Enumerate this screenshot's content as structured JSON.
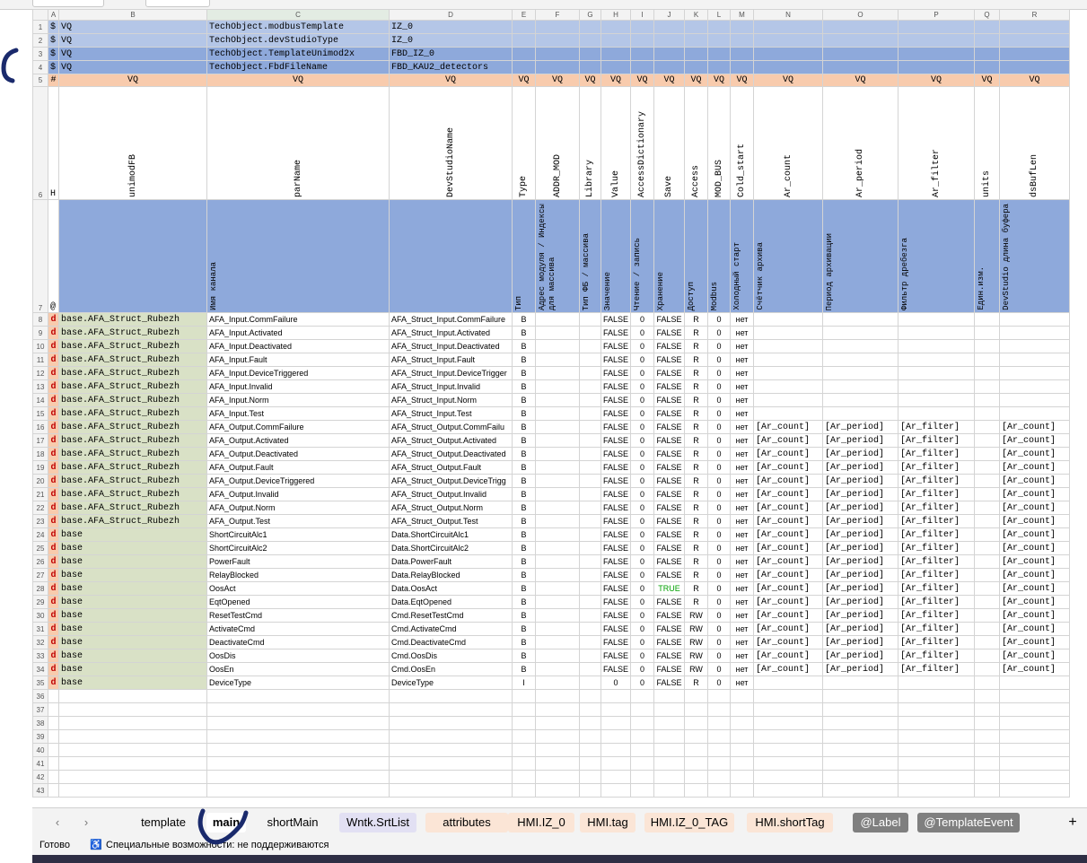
{
  "columns": [
    "A",
    "B",
    "C",
    "D",
    "E",
    "F",
    "G",
    "H",
    "I",
    "J",
    "K",
    "L",
    "M",
    "N",
    "O",
    "P",
    "Q",
    "R"
  ],
  "template_rows": [
    {
      "num": "1",
      "a": "$",
      "b": "VQ",
      "c": "TechObject.modbusTemplate",
      "d": "IZ_0"
    },
    {
      "num": "2",
      "a": "$",
      "b": "VQ",
      "c": "TechObject.devStudioType",
      "d": "IZ_0"
    },
    {
      "num": "3",
      "a": "$",
      "b": "VQ",
      "c": "TechObject.TemplateUnimod2x",
      "d": "FBD_IZ_0"
    },
    {
      "num": "4",
      "a": "$",
      "b": "VQ",
      "c": "TechObject.FbdFileName",
      "d": "FBD_KAU2_detectors"
    }
  ],
  "row5": {
    "num": "5",
    "a": "#",
    "cells": [
      "VQ",
      "VQ",
      "VQ",
      "VQ",
      "VQ",
      "VQ",
      "VQ",
      "VQ",
      "VQ",
      "VQ",
      "VQ",
      "VQ",
      "VQ",
      "VQ",
      "VQ",
      "VQ",
      "VQ"
    ]
  },
  "row6": {
    "num": "6",
    "a": "H",
    "cells": [
      "unimodFB",
      "parName",
      "DevStudioName",
      "Type",
      "ADDR_MOD",
      "Library",
      "Value",
      "AccessDictionary",
      "Save",
      "Access",
      "MOD_BUS",
      "Cold_start",
      "Ar_count",
      "Ar_period",
      "Ar_filter",
      "units",
      "dsBufLen"
    ]
  },
  "row7": {
    "num": "7",
    "a": "@",
    "cells": [
      "",
      "Имя канала",
      "",
      "Тип",
      "Адрес модуля / Индексы для массива",
      "Тип ФБ / массива",
      "Значение",
      "Чтение / запись",
      "Хранение",
      "Доступ",
      "Modbus",
      "Холодный старт",
      "Счётчик архива",
      "Период архивации",
      "Фильтр дребезга",
      "Един.изм.",
      "DevStudio длина буфера"
    ]
  },
  "data_rows": [
    {
      "num": "8",
      "a": "d",
      "b": "base.AFA_Struct_Rubezh",
      "c": "AFA_Input.CommFailure",
      "d": "AFA_Struct_Input.CommFailure",
      "e": "B",
      "h": "FALSE",
      "i": "0",
      "j": "FALSE",
      "k": "R",
      "l": "0",
      "m": "нет",
      "n": "",
      "o": "",
      "p": "",
      "r": ""
    },
    {
      "num": "9",
      "a": "d",
      "b": "base.AFA_Struct_Rubezh",
      "c": "AFA_Input.Activated",
      "d": "AFA_Struct_Input.Activated",
      "e": "B",
      "h": "FALSE",
      "i": "0",
      "j": "FALSE",
      "k": "R",
      "l": "0",
      "m": "нет",
      "n": "",
      "o": "",
      "p": "",
      "r": ""
    },
    {
      "num": "10",
      "a": "d",
      "b": "base.AFA_Struct_Rubezh",
      "c": "AFA_Input.Deactivated",
      "d": "AFA_Struct_Input.Deactivated",
      "e": "B",
      "h": "FALSE",
      "i": "0",
      "j": "FALSE",
      "k": "R",
      "l": "0",
      "m": "нет",
      "n": "",
      "o": "",
      "p": "",
      "r": ""
    },
    {
      "num": "11",
      "a": "d",
      "b": "base.AFA_Struct_Rubezh",
      "c": "AFA_Input.Fault",
      "d": "AFA_Struct_Input.Fault",
      "e": "B",
      "h": "FALSE",
      "i": "0",
      "j": "FALSE",
      "k": "R",
      "l": "0",
      "m": "нет",
      "n": "",
      "o": "",
      "p": "",
      "r": ""
    },
    {
      "num": "12",
      "a": "d",
      "b": "base.AFA_Struct_Rubezh",
      "c": "AFA_Input.DeviceTriggered",
      "d": "AFA_Struct_Input.DeviceTrigger",
      "e": "B",
      "h": "FALSE",
      "i": "0",
      "j": "FALSE",
      "k": "R",
      "l": "0",
      "m": "нет",
      "n": "",
      "o": "",
      "p": "",
      "r": ""
    },
    {
      "num": "13",
      "a": "d",
      "b": "base.AFA_Struct_Rubezh",
      "c": "AFA_Input.Invalid",
      "d": "AFA_Struct_Input.Invalid",
      "e": "B",
      "h": "FALSE",
      "i": "0",
      "j": "FALSE",
      "k": "R",
      "l": "0",
      "m": "нет",
      "n": "",
      "o": "",
      "p": "",
      "r": ""
    },
    {
      "num": "14",
      "a": "d",
      "b": "base.AFA_Struct_Rubezh",
      "c": "AFA_Input.Norm",
      "d": "AFA_Struct_Input.Norm",
      "e": "B",
      "h": "FALSE",
      "i": "0",
      "j": "FALSE",
      "k": "R",
      "l": "0",
      "m": "нет",
      "n": "",
      "o": "",
      "p": "",
      "r": ""
    },
    {
      "num": "15",
      "a": "d",
      "b": "base.AFA_Struct_Rubezh",
      "c": "AFA_Input.Test",
      "d": "AFA_Struct_Input.Test",
      "e": "B",
      "h": "FALSE",
      "i": "0",
      "j": "FALSE",
      "k": "R",
      "l": "0",
      "m": "нет",
      "n": "",
      "o": "",
      "p": "",
      "r": ""
    },
    {
      "num": "16",
      "a": "d",
      "b": "base.AFA_Struct_Rubezh",
      "c": "AFA_Output.CommFailure",
      "d": "AFA_Struct_Output.CommFailu",
      "e": "B",
      "h": "FALSE",
      "i": "0",
      "j": "FALSE",
      "k": "R",
      "l": "0",
      "m": "нет",
      "n": "[Ar_count]",
      "o": "[Ar_period]",
      "p": "[Ar_filter]",
      "r": "[Ar_count]"
    },
    {
      "num": "17",
      "a": "d",
      "b": "base.AFA_Struct_Rubezh",
      "c": "AFA_Output.Activated",
      "d": "AFA_Struct_Output.Activated",
      "e": "B",
      "h": "FALSE",
      "i": "0",
      "j": "FALSE",
      "k": "R",
      "l": "0",
      "m": "нет",
      "n": "[Ar_count]",
      "o": "[Ar_period]",
      "p": "[Ar_filter]",
      "r": "[Ar_count]"
    },
    {
      "num": "18",
      "a": "d",
      "b": "base.AFA_Struct_Rubezh",
      "c": "AFA_Output.Deactivated",
      "d": "AFA_Struct_Output.Deactivated",
      "e": "B",
      "h": "FALSE",
      "i": "0",
      "j": "FALSE",
      "k": "R",
      "l": "0",
      "m": "нет",
      "n": "[Ar_count]",
      "o": "[Ar_period]",
      "p": "[Ar_filter]",
      "r": "[Ar_count]"
    },
    {
      "num": "19",
      "a": "d",
      "b": "base.AFA_Struct_Rubezh",
      "c": "AFA_Output.Fault",
      "d": "AFA_Struct_Output.Fault",
      "e": "B",
      "h": "FALSE",
      "i": "0",
      "j": "FALSE",
      "k": "R",
      "l": "0",
      "m": "нет",
      "n": "[Ar_count]",
      "o": "[Ar_period]",
      "p": "[Ar_filter]",
      "r": "[Ar_count]"
    },
    {
      "num": "20",
      "a": "d",
      "b": "base.AFA_Struct_Rubezh",
      "c": "AFA_Output.DeviceTriggered",
      "d": "AFA_Struct_Output.DeviceTrigg",
      "e": "B",
      "h": "FALSE",
      "i": "0",
      "j": "FALSE",
      "k": "R",
      "l": "0",
      "m": "нет",
      "n": "[Ar_count]",
      "o": "[Ar_period]",
      "p": "[Ar_filter]",
      "r": "[Ar_count]"
    },
    {
      "num": "21",
      "a": "d",
      "b": "base.AFA_Struct_Rubezh",
      "c": "AFA_Output.Invalid",
      "d": "AFA_Struct_Output.Invalid",
      "e": "B",
      "h": "FALSE",
      "i": "0",
      "j": "FALSE",
      "k": "R",
      "l": "0",
      "m": "нет",
      "n": "[Ar_count]",
      "o": "[Ar_period]",
      "p": "[Ar_filter]",
      "r": "[Ar_count]"
    },
    {
      "num": "22",
      "a": "d",
      "b": "base.AFA_Struct_Rubezh",
      "c": "AFA_Output.Norm",
      "d": "AFA_Struct_Output.Norm",
      "e": "B",
      "h": "FALSE",
      "i": "0",
      "j": "FALSE",
      "k": "R",
      "l": "0",
      "m": "нет",
      "n": "[Ar_count]",
      "o": "[Ar_period]",
      "p": "[Ar_filter]",
      "r": "[Ar_count]"
    },
    {
      "num": "23",
      "a": "d",
      "b": "base.AFA_Struct_Rubezh",
      "c": "AFA_Output.Test",
      "d": "AFA_Struct_Output.Test",
      "e": "B",
      "h": "FALSE",
      "i": "0",
      "j": "FALSE",
      "k": "R",
      "l": "0",
      "m": "нет",
      "n": "[Ar_count]",
      "o": "[Ar_period]",
      "p": "[Ar_filter]",
      "r": "[Ar_count]"
    },
    {
      "num": "24",
      "a": "d",
      "b": "base",
      "c": "ShortCircuitAlc1",
      "d": "Data.ShortCircuitAlc1",
      "e": "B",
      "h": "FALSE",
      "i": "0",
      "j": "FALSE",
      "k": "R",
      "l": "0",
      "m": "нет",
      "n": "[Ar_count]",
      "o": "[Ar_period]",
      "p": "[Ar_filter]",
      "r": "[Ar_count]"
    },
    {
      "num": "25",
      "a": "d",
      "b": "base",
      "c": "ShortCircuitAlc2",
      "d": "Data.ShortCircuitAlc2",
      "e": "B",
      "h": "FALSE",
      "i": "0",
      "j": "FALSE",
      "k": "R",
      "l": "0",
      "m": "нет",
      "n": "[Ar_count]",
      "o": "[Ar_period]",
      "p": "[Ar_filter]",
      "r": "[Ar_count]"
    },
    {
      "num": "26",
      "a": "d",
      "b": "base",
      "c": "PowerFault",
      "d": "Data.PowerFault",
      "e": "B",
      "h": "FALSE",
      "i": "0",
      "j": "FALSE",
      "k": "R",
      "l": "0",
      "m": "нет",
      "n": "[Ar_count]",
      "o": "[Ar_period]",
      "p": "[Ar_filter]",
      "r": "[Ar_count]"
    },
    {
      "num": "27",
      "a": "d",
      "b": "base",
      "c": "RelayBlocked",
      "d": "Data.RelayBlocked",
      "e": "B",
      "h": "FALSE",
      "i": "0",
      "j": "FALSE",
      "k": "R",
      "l": "0",
      "m": "нет",
      "n": "[Ar_count]",
      "o": "[Ar_period]",
      "p": "[Ar_filter]",
      "r": "[Ar_count]"
    },
    {
      "num": "28",
      "a": "d",
      "b": "base",
      "c": "OosAct",
      "d": "Data.OosAct",
      "e": "B",
      "h": "FALSE",
      "i": "0",
      "j": "TRUE",
      "k": "R",
      "l": "0",
      "m": "нет",
      "n": "[Ar_count]",
      "o": "[Ar_period]",
      "p": "[Ar_filter]",
      "r": "[Ar_count]"
    },
    {
      "num": "29",
      "a": "d",
      "b": "base",
      "c": "EqtOpened",
      "d": "Data.EqtOpened",
      "e": "B",
      "h": "FALSE",
      "i": "0",
      "j": "FALSE",
      "k": "R",
      "l": "0",
      "m": "нет",
      "n": "[Ar_count]",
      "o": "[Ar_period]",
      "p": "[Ar_filter]",
      "r": "[Ar_count]"
    },
    {
      "num": "30",
      "a": "d",
      "b": "base",
      "c": "ResetTestCmd",
      "d": "Cmd.ResetTestCmd",
      "e": "B",
      "h": "FALSE",
      "i": "0",
      "j": "FALSE",
      "k": "RW",
      "l": "0",
      "m": "нет",
      "n": "[Ar_count]",
      "o": "[Ar_period]",
      "p": "[Ar_filter]",
      "r": "[Ar_count]"
    },
    {
      "num": "31",
      "a": "d",
      "b": "base",
      "c": "ActivateCmd",
      "d": "Cmd.ActivateCmd",
      "e": "B",
      "h": "FALSE",
      "i": "0",
      "j": "FALSE",
      "k": "RW",
      "l": "0",
      "m": "нет",
      "n": "[Ar_count]",
      "o": "[Ar_period]",
      "p": "[Ar_filter]",
      "r": "[Ar_count]"
    },
    {
      "num": "32",
      "a": "d",
      "b": "base",
      "c": "DeactivateCmd",
      "d": "Cmd.DeactivateCmd",
      "e": "B",
      "h": "FALSE",
      "i": "0",
      "j": "FALSE",
      "k": "RW",
      "l": "0",
      "m": "нет",
      "n": "[Ar_count]",
      "o": "[Ar_period]",
      "p": "[Ar_filter]",
      "r": "[Ar_count]"
    },
    {
      "num": "33",
      "a": "d",
      "b": "base",
      "c": "OosDis",
      "d": "Cmd.OosDis",
      "e": "B",
      "h": "FALSE",
      "i": "0",
      "j": "FALSE",
      "k": "RW",
      "l": "0",
      "m": "нет",
      "n": "[Ar_count]",
      "o": "[Ar_period]",
      "p": "[Ar_filter]",
      "r": "[Ar_count]"
    },
    {
      "num": "34",
      "a": "d",
      "b": "base",
      "c": "OosEn",
      "d": "Cmd.OosEn",
      "e": "B",
      "h": "FALSE",
      "i": "0",
      "j": "FALSE",
      "k": "RW",
      "l": "0",
      "m": "нет",
      "n": "[Ar_count]",
      "o": "[Ar_period]",
      "p": "[Ar_filter]",
      "r": "[Ar_count]"
    },
    {
      "num": "35",
      "a": "d",
      "b": "base",
      "c": "DeviceType",
      "d": "DeviceType",
      "e": "I",
      "h": "0",
      "i": "0",
      "j": "FALSE",
      "k": "R",
      "l": "0",
      "m": "нет",
      "n": "",
      "o": "",
      "p": "",
      "r": ""
    }
  ],
  "empty_rows": [
    "36",
    "37",
    "38",
    "39",
    "40",
    "41",
    "42",
    "43"
  ],
  "tabs": [
    {
      "label": "template",
      "style": "plain"
    },
    {
      "label": "main",
      "style": "active"
    },
    {
      "label": "shortMain",
      "style": "plain"
    },
    {
      "label": "Wntk.SrtList",
      "style": "purple"
    },
    {
      "label": "attributes",
      "style": "orange"
    },
    {
      "label": "HMI.IZ_0",
      "style": "orange"
    },
    {
      "label": "HMI.tag",
      "style": "orange"
    },
    {
      "label": "HMI.IZ_0_TAG",
      "style": "orange"
    },
    {
      "label": "HMI.shortTag",
      "style": "orange"
    },
    {
      "label": "@Label",
      "style": "gray"
    },
    {
      "label": "@TemplateEvent",
      "style": "gray"
    }
  ],
  "nav": {
    "prev": "‹",
    "next": "›",
    "add": "+"
  },
  "status": {
    "ready": "Готово",
    "accessibility": "Специальные возможности: не поддерживаются"
  },
  "colors": {
    "header_blue": "#b4c6e7",
    "dark_blue": "#8ea9db",
    "orange": "#f8cbad",
    "green_base": "#d9e1c6",
    "ink": "#1a2a6c"
  }
}
